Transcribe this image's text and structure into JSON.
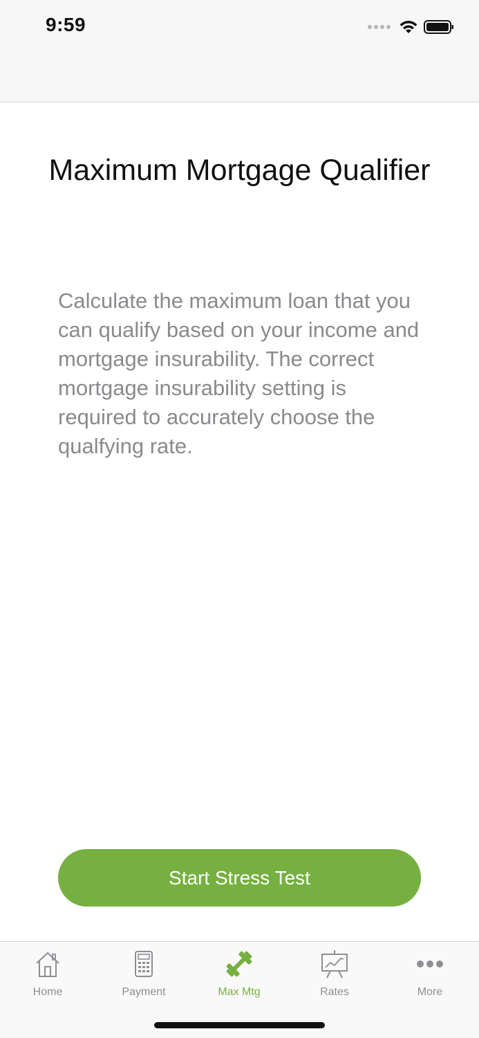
{
  "status_bar": {
    "time": "9:59",
    "icons": [
      "signal-dots-icon",
      "wifi-icon",
      "battery-icon"
    ]
  },
  "page": {
    "title": "Maximum Mortgage Qualifier",
    "description": "Calculate the maximum loan that you can qualify based on your income and mortgage insurability. The correct mortgage insurability setting is required to accurately choose the qualfying rate."
  },
  "primary_button": {
    "label": "Start Stress Test"
  },
  "tab_bar": {
    "items": [
      {
        "label": "Home",
        "icon": "house-icon",
        "active": false
      },
      {
        "label": "Payment",
        "icon": "calculator-icon",
        "active": false
      },
      {
        "label": "Max Mtg",
        "icon": "dumbbell-icon",
        "active": true
      },
      {
        "label": "Rates",
        "icon": "chart-board-icon",
        "active": false
      },
      {
        "label": "More",
        "icon": "ellipsis-icon",
        "active": false
      }
    ]
  },
  "colors": {
    "accent": "#76b041",
    "tab_inactive": "#8e8e93",
    "description_text": "#8a8a8e"
  }
}
